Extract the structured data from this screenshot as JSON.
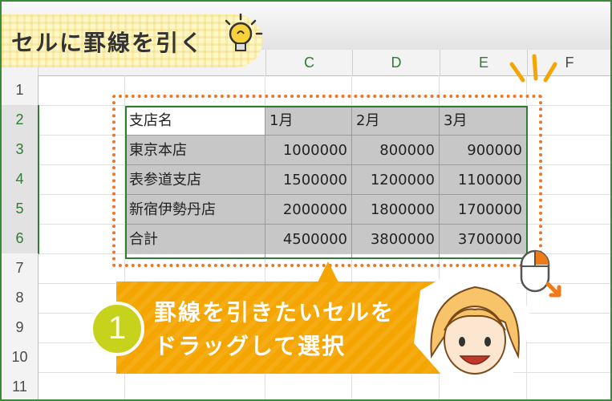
{
  "title": "セルに罫線を引く",
  "columns": [
    "C",
    "D",
    "E",
    "F"
  ],
  "rows": [
    "1",
    "2",
    "3",
    "4",
    "5",
    "6",
    "7",
    "8",
    "9",
    "10",
    "11"
  ],
  "table": {
    "header": [
      "支店名",
      "1月",
      "2月",
      "3月"
    ],
    "body": [
      [
        "東京本店",
        "1000000",
        "800000",
        "900000"
      ],
      [
        "表参道支店",
        "1500000",
        "1200000",
        "1100000"
      ],
      [
        "新宿伊勢丹店",
        "2000000",
        "1800000",
        "1700000"
      ],
      [
        "合計",
        "4500000",
        "3800000",
        "3700000"
      ]
    ]
  },
  "step": {
    "number": "1",
    "line1": "罫線を引きたいセルを",
    "line2": "ドラッグして選択"
  },
  "colors": {
    "selection": "#2e7d32",
    "highlight_gray": "#c7c7c7",
    "dotted": "#e9772a",
    "banner": "#f5a500",
    "step_circle": "#c7d21c"
  }
}
